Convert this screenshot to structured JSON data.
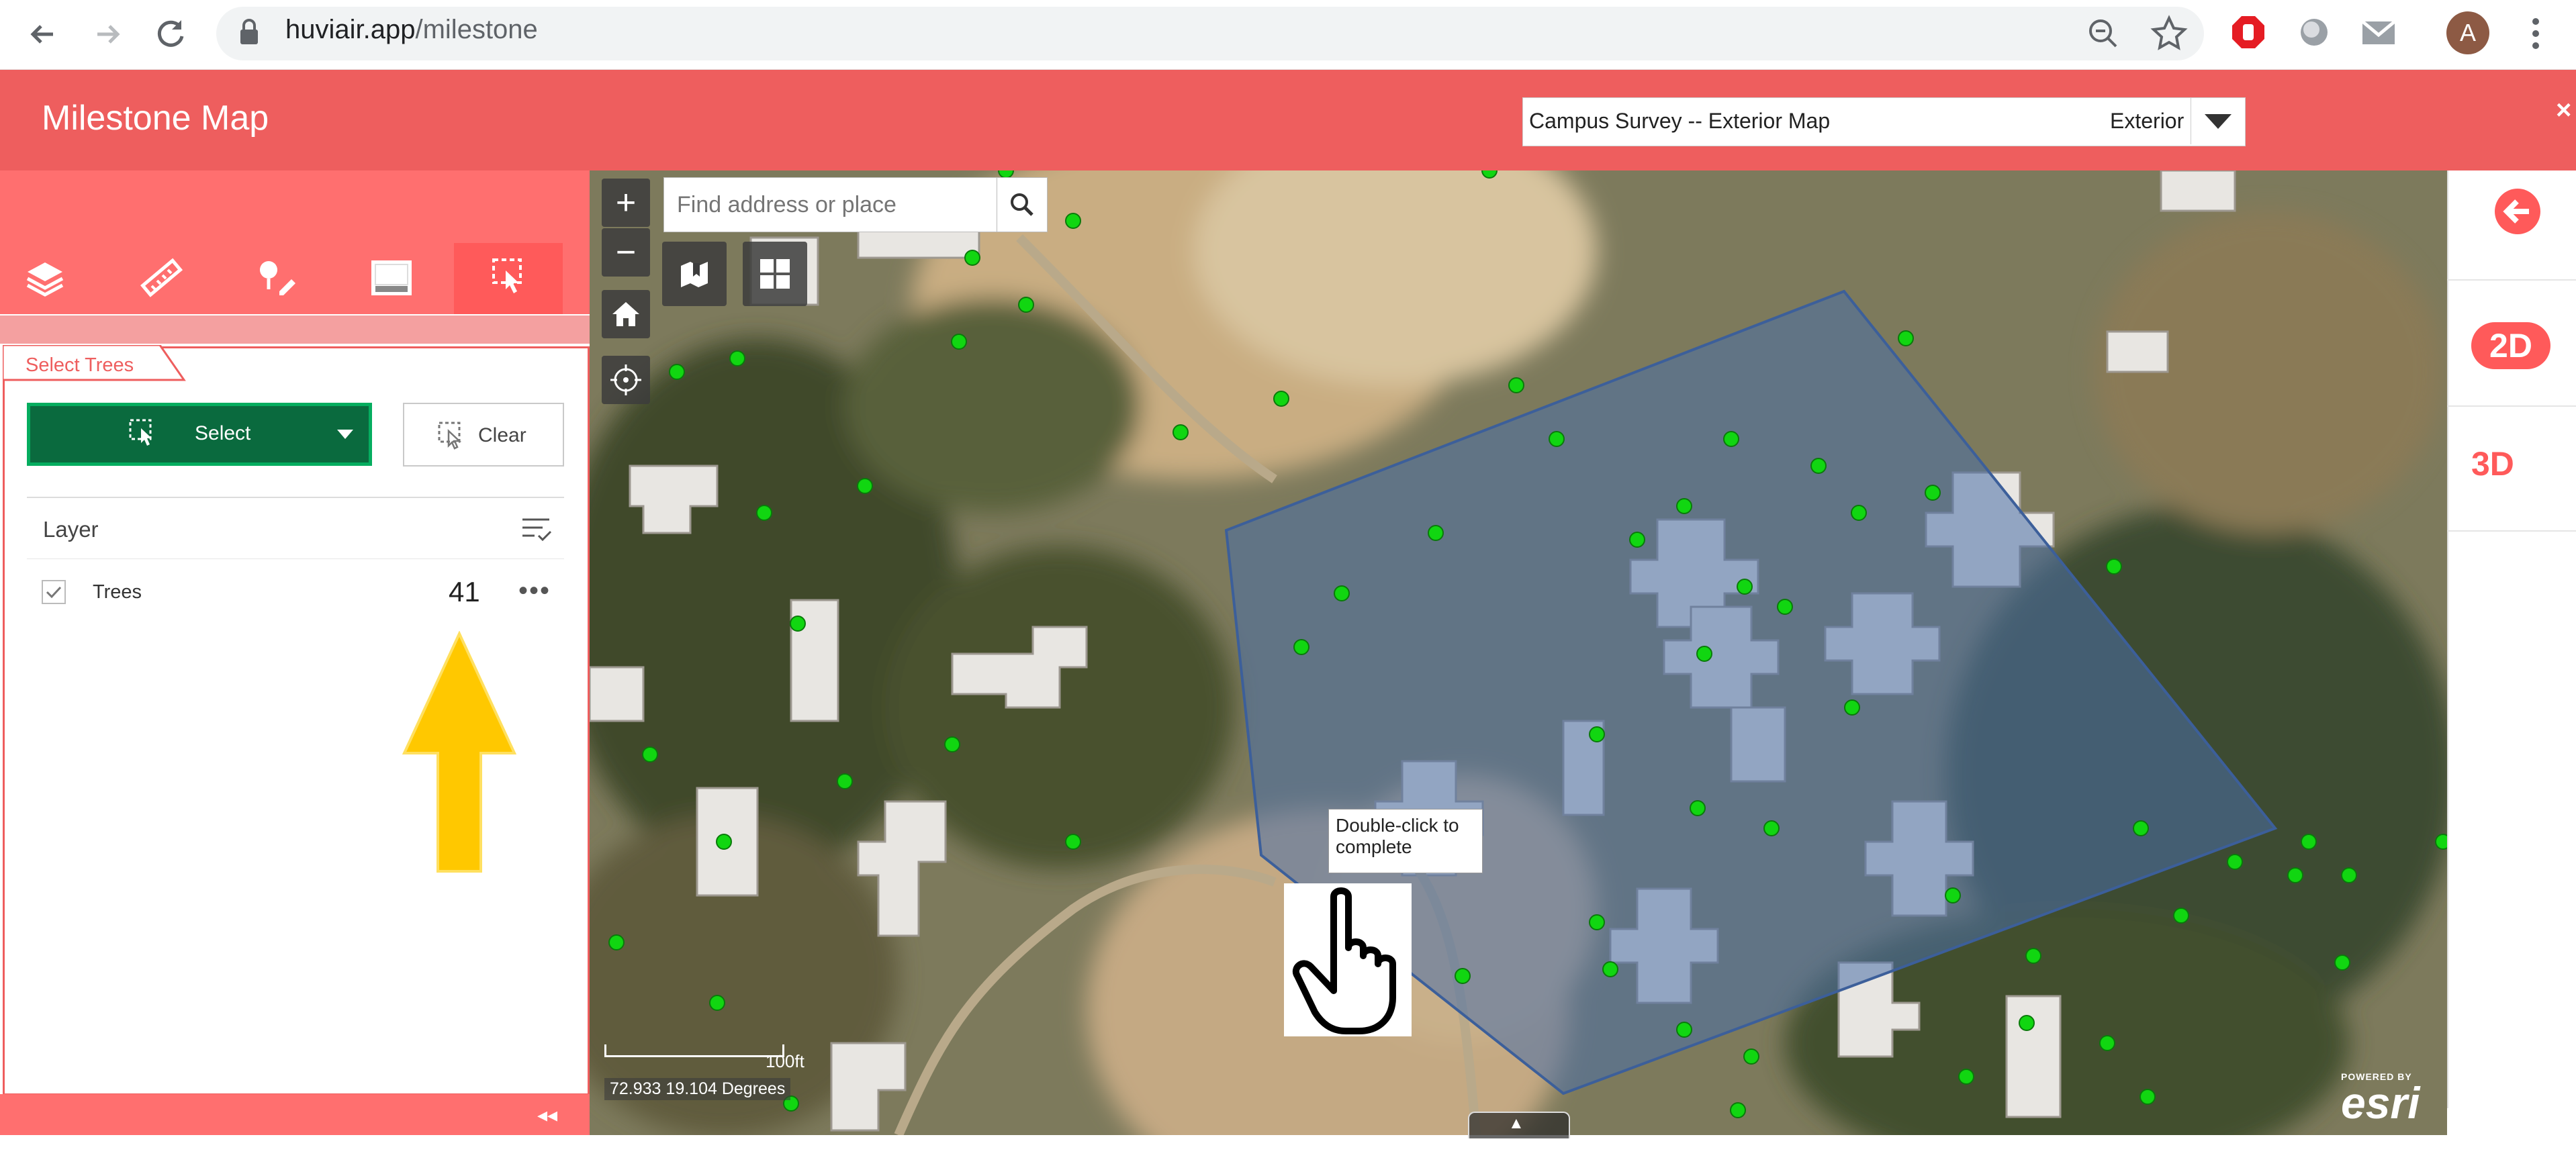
{
  "browser": {
    "url_domain": "huviair.app",
    "url_path": "/milestone",
    "profile_initial": "A"
  },
  "app": {
    "title": "Milestone Map",
    "map_selector": {
      "selected": "Campus Survey -- Exterior Map",
      "suffix": "Exterior"
    },
    "close_glyph": "×"
  },
  "toolbar": {
    "tools": [
      "layers-icon",
      "ruler-icon",
      "draw-icon",
      "basemap-icon",
      "select-trees-icon"
    ],
    "active": "select-trees-icon"
  },
  "widget": {
    "tab_label": "Select Trees",
    "select_label": "Select",
    "clear_label": "Clear",
    "layer_heading": "Layer",
    "layers": [
      {
        "name": "Trees",
        "checked": true,
        "count": "41"
      }
    ],
    "more_glyph": "•••",
    "collapse_glyph": "◂◂"
  },
  "map": {
    "search_placeholder": "Find address or place",
    "zoom_in": "+",
    "zoom_out": "−",
    "tooltip": "Double-click to complete",
    "scale_label": "100ft",
    "coordinates": "72.933 19.104 Degrees",
    "attribution_small": "POWERED BY",
    "attribution_big": "esri",
    "caret_glyph": "▲"
  },
  "view_modes": {
    "mode_2d": "2D",
    "mode_3d": "3D"
  },
  "colors": {
    "header": "#ee5e5e",
    "toolbar": "#ff6f6f",
    "select_button": "#0a6a3e",
    "select_button_border": "#05ad5f",
    "polygon_fill": "rgba(74,112,168,0.55)",
    "tree_point": "#11d611",
    "annotation_arrow": "#ffc800"
  }
}
